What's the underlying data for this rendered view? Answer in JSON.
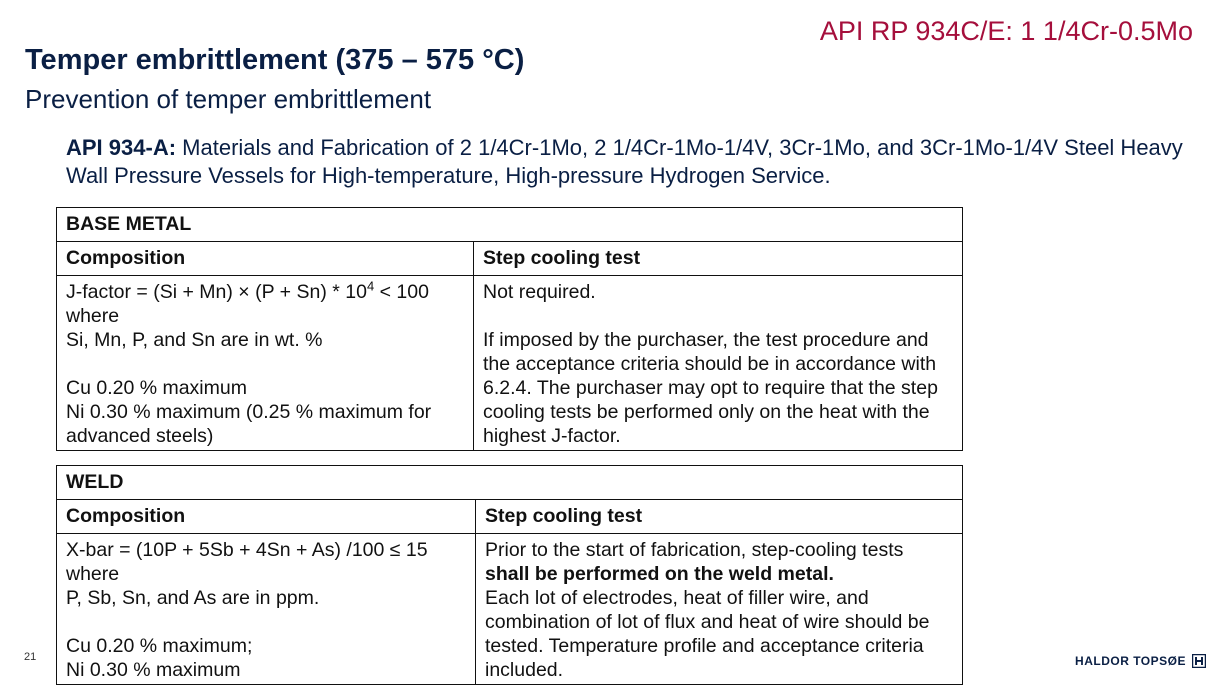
{
  "header": {
    "top_right": "API RP 934C/E: 1 1/4Cr-0.5Mo",
    "title": "Temper embrittlement (375 – 575 °C)",
    "subtitle": "Prevention of temper embrittlement"
  },
  "intro": {
    "lead": "API 934-A:",
    "text": " Materials and Fabrication of 2 1/4Cr-1Mo, 2 1/4Cr-1Mo-1/4V, 3Cr-1Mo, and 3Cr-1Mo-1/4V Steel Heavy Wall Pressure Vessels for High-temperature, High-pressure Hydrogen Service."
  },
  "base_metal": {
    "section": "BASE METAL",
    "col_composition": "Composition",
    "col_step": "Step cooling test",
    "composition": {
      "jfactor_pre": "J-factor = (Si + Mn) × (P + Sn) * 10",
      "jfactor_sup": "4",
      "jfactor_post": " < 100",
      "where": "where",
      "units": "Si, Mn, P, and Sn are in wt. %",
      "cu": "Cu 0.20 % maximum",
      "ni_1": "Ni 0.30 % maximum (0.25 % maximum for",
      "ni_2": "advanced steels)"
    },
    "step": {
      "l1": "Not required.",
      "l2": "If imposed by the purchaser, the test procedure and",
      "l3": "the acceptance criteria should be in accordance with",
      "l4": "6.2.4. The purchaser may opt to require that the step",
      "l5": "cooling tests be performed only on the heat with the",
      "l6": "highest J-factor."
    }
  },
  "weld": {
    "section": "WELD",
    "col_composition": "Composition",
    "col_step": "Step cooling test",
    "composition": {
      "xbar": "X-bar = (10P + 5Sb + 4Sn + As) /100 ≤ 15",
      "where": "where",
      "units": "P, Sb, Sn, and As are in ppm.",
      "cu": "Cu 0.20 % maximum;",
      "ni": "Ni 0.30 % maximum"
    },
    "step": {
      "l1": "Prior to the start of fabrication, step-cooling tests",
      "l2_bold": "shall be performed on the weld metal.",
      "l3": "Each lot of electrodes, heat of filler wire, and",
      "l4": "combination of lot of flux and heat of wire should be",
      "l5": "tested. Temperature profile and acceptance criteria",
      "l6": "included."
    }
  },
  "footer": {
    "page_number": "21",
    "logo_text": "HALDOR TOPSØE"
  }
}
